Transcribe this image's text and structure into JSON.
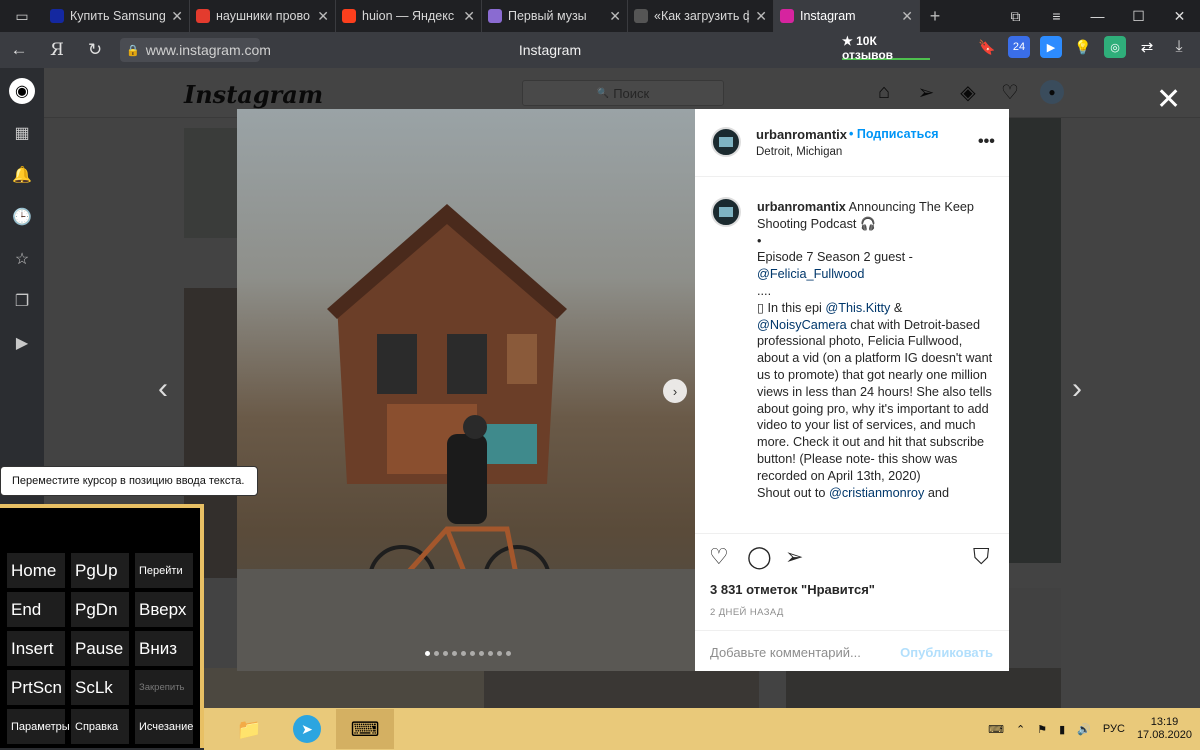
{
  "browser": {
    "tabs": [
      {
        "label": "Купить Samsung",
        "favicon": "samsung-icon",
        "fav_color": "#1428a0",
        "active": false
      },
      {
        "label": "наушники прово",
        "favicon": "shop-icon",
        "fav_color": "#e33b2e",
        "active": false
      },
      {
        "label": "huion — Яндекс",
        "favicon": "yandex-icon",
        "fav_color": "#fc3f1d",
        "active": false
      },
      {
        "label": "Первый музы",
        "favicon": "music-icon",
        "fav_color": "#8a6bd1",
        "active": false
      },
      {
        "label": "«Как загрузить ф",
        "favicon": "quote-icon",
        "fav_color": "#555555",
        "active": false
      },
      {
        "label": "Instagram",
        "favicon": "instagram-icon",
        "fav_color": "#d6249f",
        "active": true
      }
    ],
    "url": "www.instagram.com",
    "page_title": "Instagram",
    "reviews_badge": "★ 10К отзывов"
  },
  "instagram": {
    "logo": "Instagram",
    "search_placeholder": "Поиск",
    "post": {
      "username": "urbanromantix",
      "follow_label": "• Подписаться",
      "location": "Detroit, Michigan",
      "caption_user": "urbanromantix",
      "caption_line1": " Announcing The Keep Shooting Podcast 🎧",
      "caption_bullet": "•",
      "caption_line2": "Episode 7 Season 2 guest -",
      "caption_mention1": "@Felicia_Fullwood",
      "caption_dots": "....",
      "caption_line3a": "▯ In this epi ",
      "caption_mention2": "@This.Kitty",
      "caption_line3b": " &",
      "caption_mention3": "@NoisyCamera",
      "caption_line3c": " chat with Detroit-based professional photo, Felicia Fullwood, about a vid (on a platform IG doesn't want us to promote) that got nearly one million views in less than 24 hours! She also tells about going pro, why it's important to add video to your list of services, and much more. Check it out and hit that subscribe button! (Please note- this show was recorded on April 13th, 2020)",
      "caption_line4": "Shout out to ",
      "caption_mention4": "@cristianmonroy",
      "caption_line4b": " and",
      "likes": "3 831 отметок \"Нравится\"",
      "date": "2 ДНЕЙ НАЗАД",
      "comment_placeholder": "Добавьте комментарий...",
      "publish_label": "Опубликовать"
    }
  },
  "tooltip": "Переместите курсор в позицию ввода текста.",
  "osk": {
    "keys": [
      {
        "label": "Home",
        "size": ""
      },
      {
        "label": "PgUp",
        "size": ""
      },
      {
        "label": "Перейти",
        "size": "sm"
      },
      {
        "label": "End",
        "size": ""
      },
      {
        "label": "PgDn",
        "size": ""
      },
      {
        "label": "Вверх",
        "size": ""
      },
      {
        "label": "Insert",
        "size": ""
      },
      {
        "label": "Pause",
        "size": ""
      },
      {
        "label": "Вниз",
        "size": ""
      },
      {
        "label": "PrtScn",
        "size": ""
      },
      {
        "label": "ScLk",
        "size": ""
      },
      {
        "label": "Закрепить",
        "size": "xs"
      },
      {
        "label": "Параметры",
        "size": "sm"
      },
      {
        "label": "Справка",
        "size": "sm"
      },
      {
        "label": "Исчезание",
        "size": "sm"
      }
    ]
  },
  "taskbar": {
    "language": "РУС",
    "time": "13:19",
    "date": "17.08.2020"
  }
}
